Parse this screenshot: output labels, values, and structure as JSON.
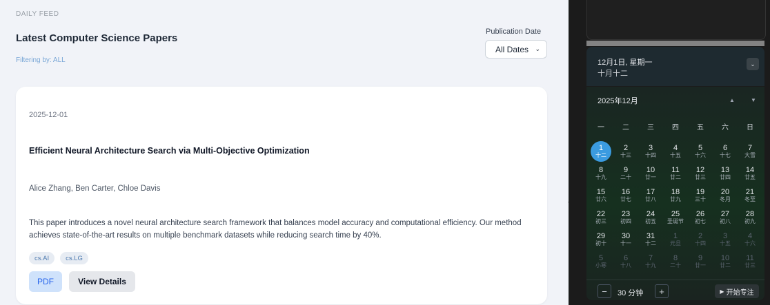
{
  "feed": {
    "label": "DAILY FEED",
    "title": "Latest Computer Science Papers",
    "filter": "Filtering by: ALL",
    "pub_date_label": "Publication Date",
    "date_select_value": "All Dates"
  },
  "paper": {
    "date": "2025-12-01",
    "title": "Efficient Neural Architecture Search via Multi-Objective Optimization",
    "authors": "Alice Zhang, Ben Carter, Chloe Davis",
    "abstract": "This paper introduces a novel neural architecture search framework that balances model accuracy and computational efficiency. Our method achieves state-of-the-art results on multiple benchmark datasets while reducing search time by 40%.",
    "tags": [
      "cs.AI",
      "cs.LG"
    ],
    "pdf_label": "PDF",
    "details_label": "View Details"
  },
  "calendar": {
    "header_date": "12月1日, 星期一",
    "header_lunar": "十月十二",
    "month_label": "2025年12月",
    "weekdays": [
      "一",
      "二",
      "三",
      "四",
      "五",
      "六",
      "日"
    ],
    "days": [
      {
        "d": "1",
        "l": "十二",
        "selected": true
      },
      {
        "d": "2",
        "l": "十三"
      },
      {
        "d": "3",
        "l": "十四"
      },
      {
        "d": "4",
        "l": "十五"
      },
      {
        "d": "5",
        "l": "十六"
      },
      {
        "d": "6",
        "l": "十七"
      },
      {
        "d": "7",
        "l": "大雪"
      },
      {
        "d": "8",
        "l": "十九"
      },
      {
        "d": "9",
        "l": "二十"
      },
      {
        "d": "10",
        "l": "廿一"
      },
      {
        "d": "11",
        "l": "廿二"
      },
      {
        "d": "12",
        "l": "廿三"
      },
      {
        "d": "13",
        "l": "廿四"
      },
      {
        "d": "14",
        "l": "廿五"
      },
      {
        "d": "15",
        "l": "廿六"
      },
      {
        "d": "16",
        "l": "廿七"
      },
      {
        "d": "17",
        "l": "廿八"
      },
      {
        "d": "18",
        "l": "廿九"
      },
      {
        "d": "19",
        "l": "三十"
      },
      {
        "d": "20",
        "l": "冬月"
      },
      {
        "d": "21",
        "l": "冬至"
      },
      {
        "d": "22",
        "l": "初三"
      },
      {
        "d": "23",
        "l": "初四"
      },
      {
        "d": "24",
        "l": "初五"
      },
      {
        "d": "25",
        "l": "圣诞节"
      },
      {
        "d": "26",
        "l": "初七"
      },
      {
        "d": "27",
        "l": "初八"
      },
      {
        "d": "28",
        "l": "初九"
      },
      {
        "d": "29",
        "l": "初十"
      },
      {
        "d": "30",
        "l": "十一"
      },
      {
        "d": "31",
        "l": "十二"
      },
      {
        "d": "1",
        "l": "元旦",
        "other": true
      },
      {
        "d": "2",
        "l": "十四",
        "other": true
      },
      {
        "d": "3",
        "l": "十五",
        "other": true
      },
      {
        "d": "4",
        "l": "十六",
        "other": true
      },
      {
        "d": "5",
        "l": "小寒",
        "other": true
      },
      {
        "d": "6",
        "l": "十八",
        "other": true
      },
      {
        "d": "7",
        "l": "十九",
        "other": true
      },
      {
        "d": "8",
        "l": "二十",
        "other": true
      },
      {
        "d": "9",
        "l": "廿一",
        "other": true
      },
      {
        "d": "10",
        "l": "廿二",
        "other": true
      },
      {
        "d": "11",
        "l": "廿三",
        "other": true
      }
    ],
    "focus_minus": "−",
    "focus_time": "30 分钟",
    "focus_plus": "+",
    "start_label": "开始专注"
  }
}
